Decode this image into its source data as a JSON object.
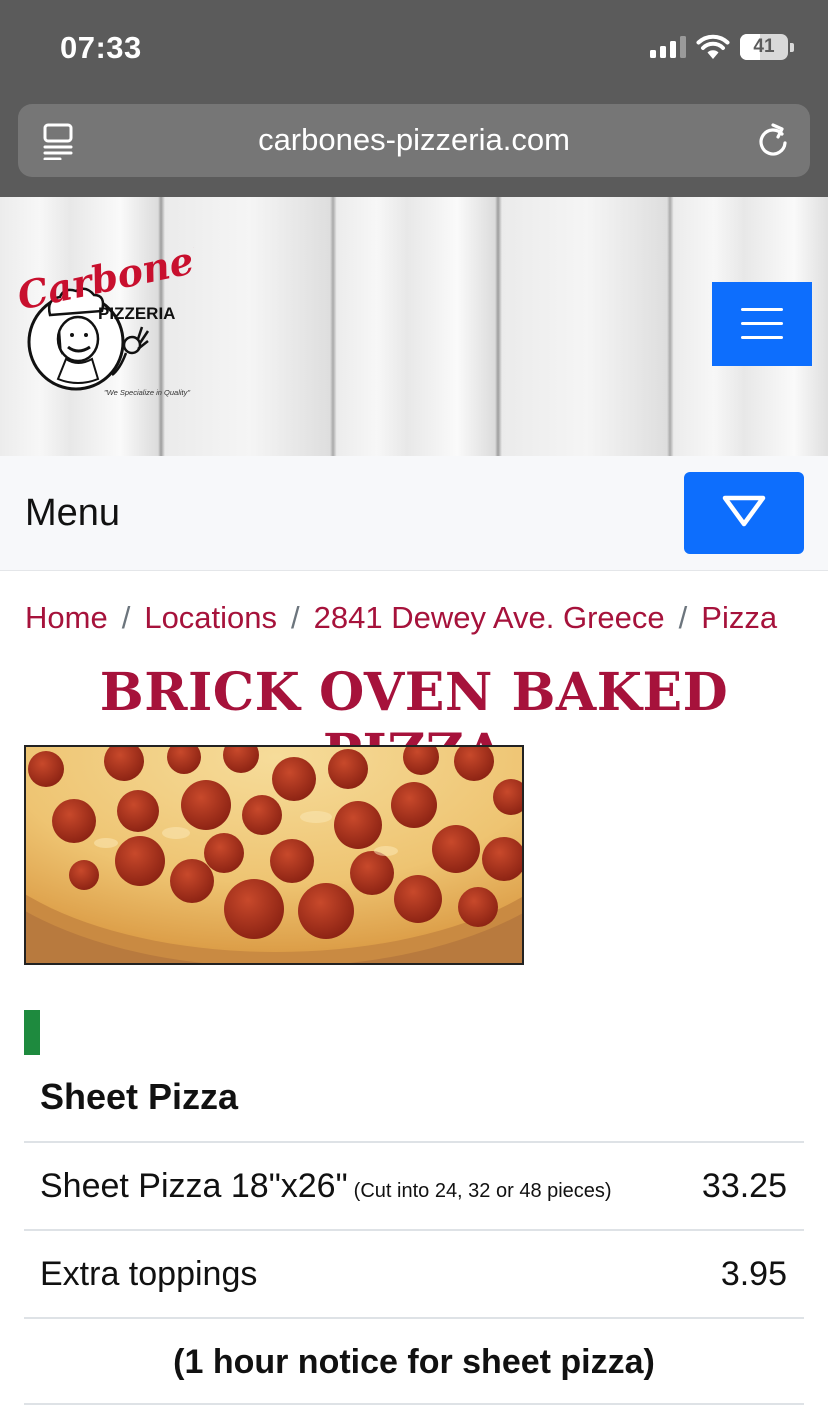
{
  "status_bar": {
    "time": "07:33",
    "battery": "41",
    "battery_level": 0.41
  },
  "browser": {
    "url": "carbones-pizzeria.com"
  },
  "header": {
    "logo": {
      "brand": "Carbone's",
      "subtitle": "PIZZERIA",
      "tagline": "\"We Specialize in Quality\""
    }
  },
  "menu_bar": {
    "label": "Menu"
  },
  "breadcrumb": {
    "items": [
      "Home",
      "Locations",
      "2841 Dewey Ave. Greece",
      "Pizza"
    ],
    "separator": "/"
  },
  "page": {
    "title": "BRICK OVEN BAKED PIZZA"
  },
  "section": {
    "title": "Sheet Pizza",
    "accent_color": "#1e8a3e",
    "rows": [
      {
        "name": "Sheet Pizza 18\"x26\"",
        "note": "(Cut into 24, 32 or 48 pieces)",
        "price": "33.25"
      },
      {
        "name": "Extra toppings",
        "note": "",
        "price": "3.95"
      }
    ],
    "notice": "(1 hour notice for sheet pizza)"
  },
  "colors": {
    "brand_red": "#a6123b",
    "button_blue": "#0d6efd"
  }
}
